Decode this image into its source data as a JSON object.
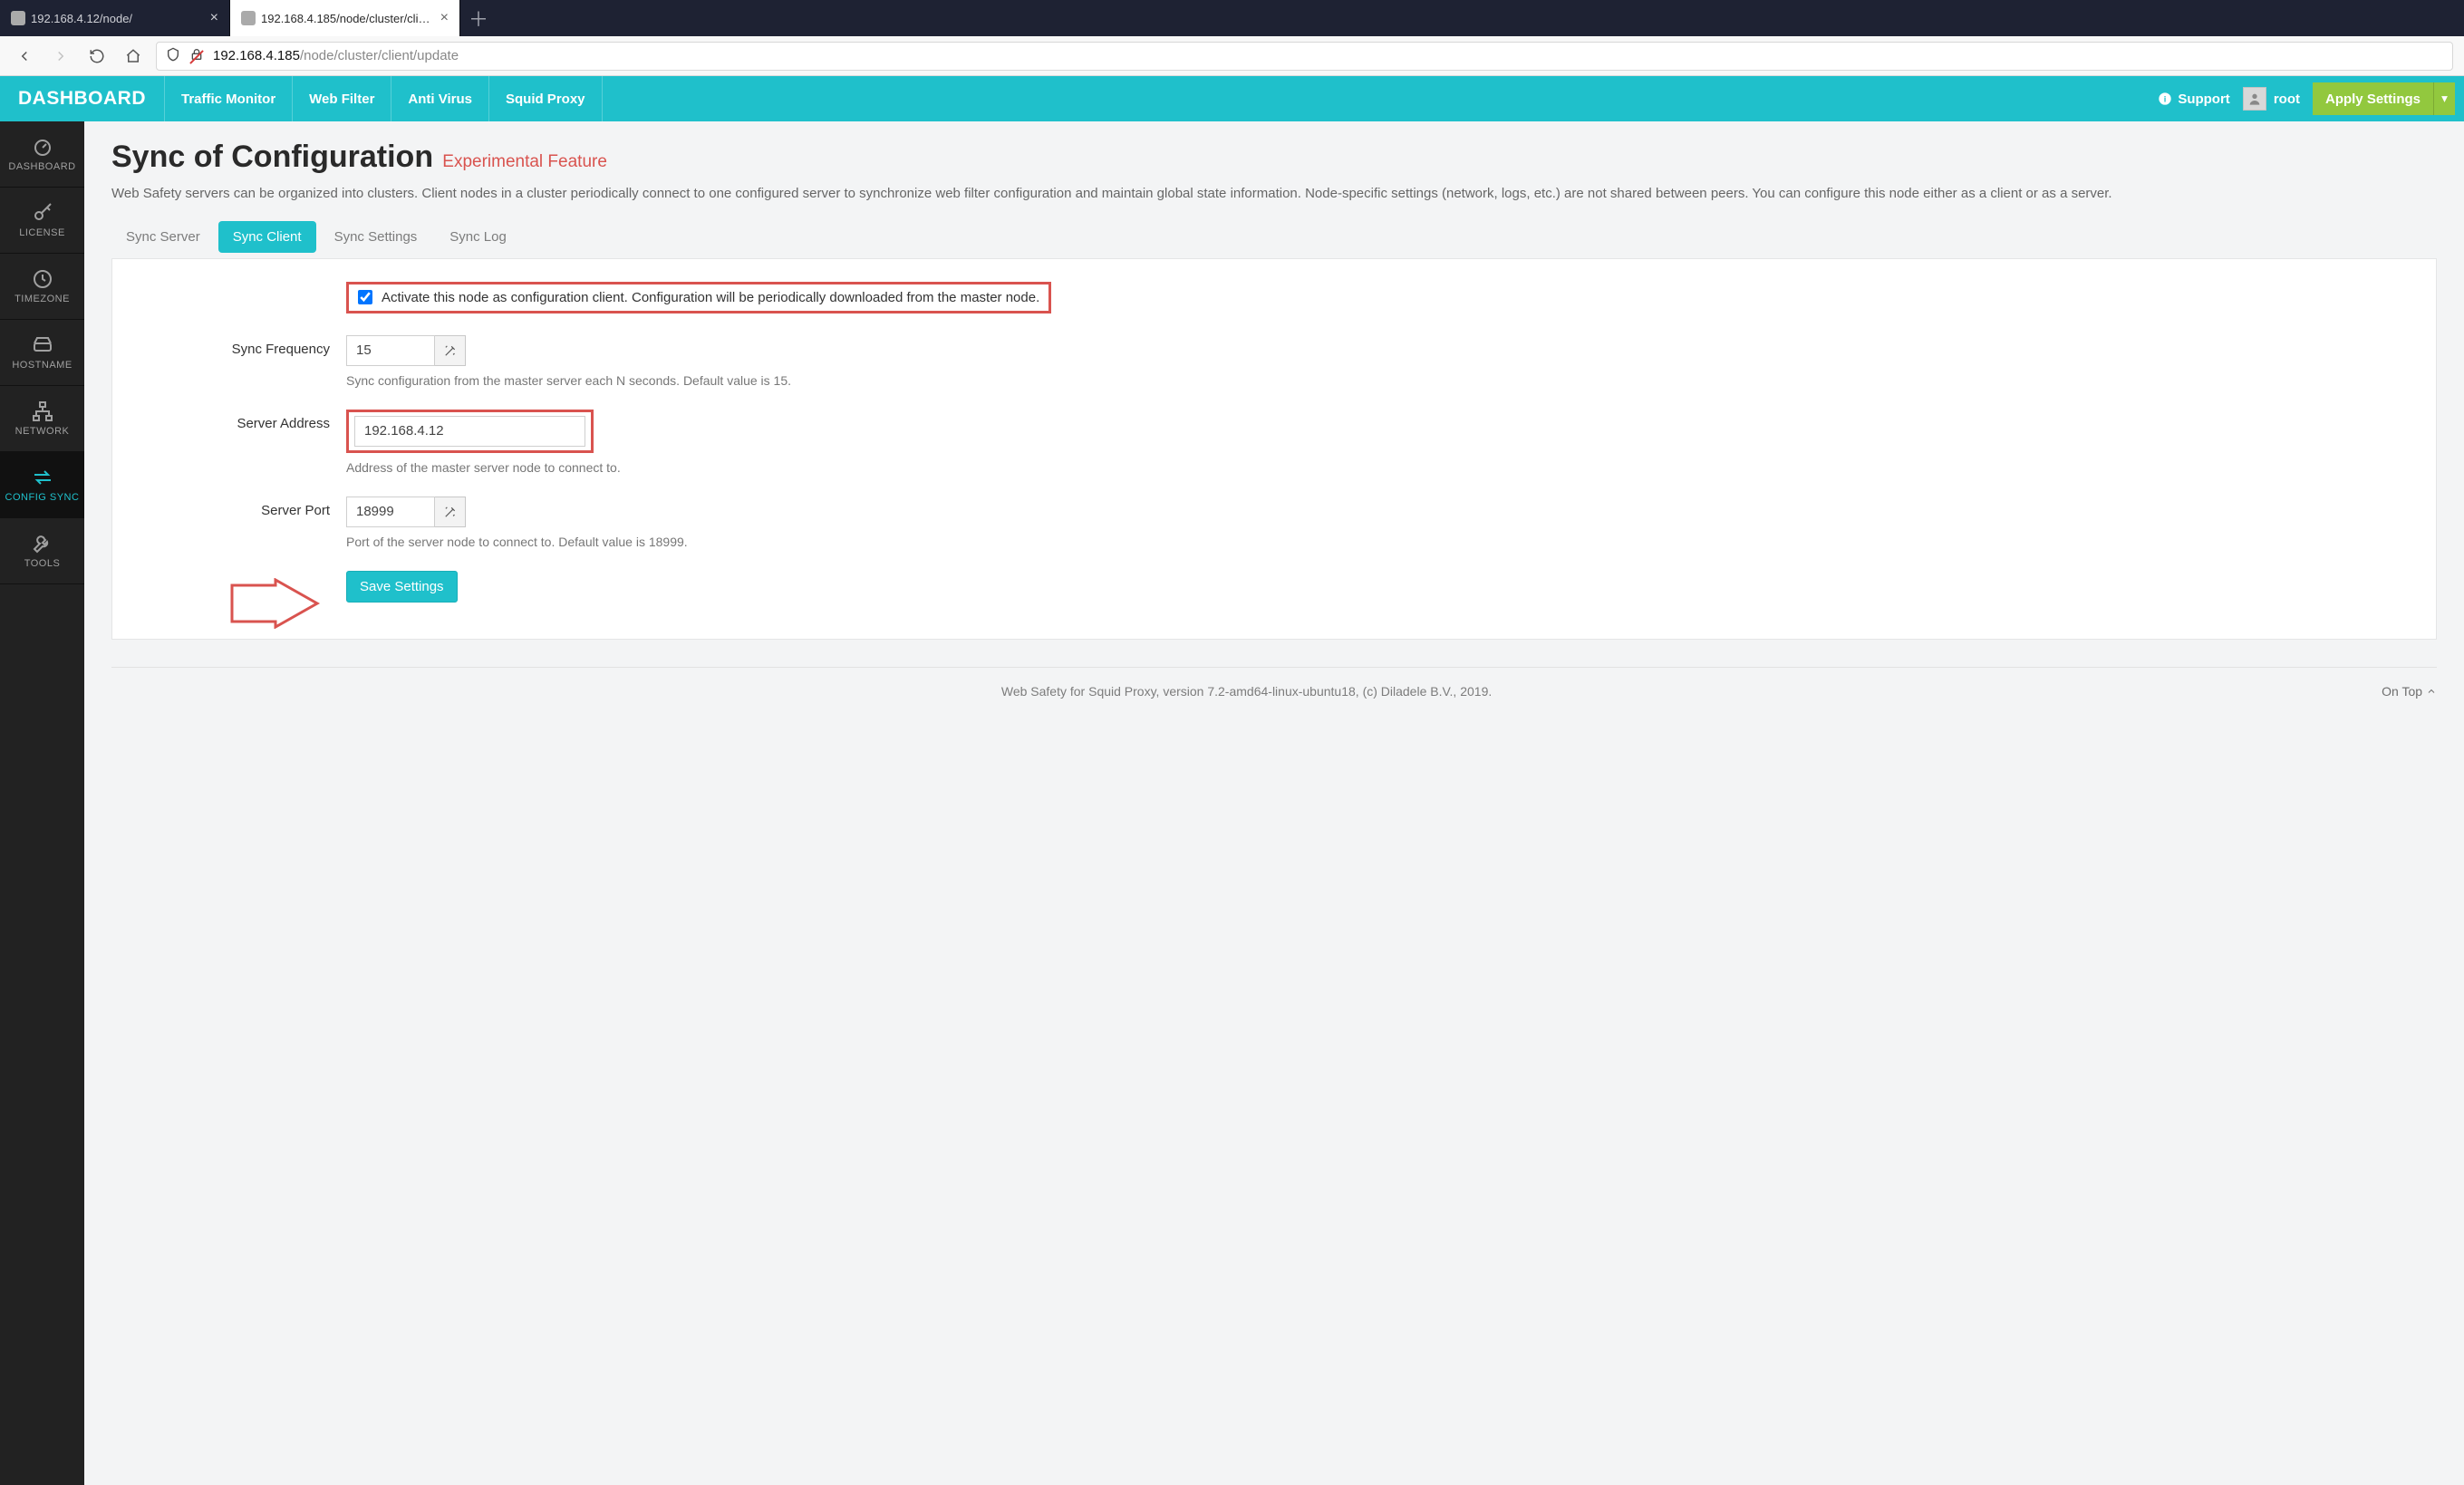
{
  "browser": {
    "tabs": [
      {
        "label": "192.168.4.12/node/",
        "active": false
      },
      {
        "label": "192.168.4.185/node/cluster/client/u",
        "active": true
      }
    ],
    "url_host": "192.168.4.185",
    "url_path": "/node/cluster/client/update"
  },
  "topnav": {
    "brand": "DASHBOARD",
    "links": [
      "Traffic Monitor",
      "Web Filter",
      "Anti Virus",
      "Squid Proxy"
    ],
    "support": "Support",
    "user": "root",
    "apply": "Apply Settings"
  },
  "sidebar": {
    "items": [
      {
        "label": "DASHBOARD",
        "icon": "gauge"
      },
      {
        "label": "LICENSE",
        "icon": "key"
      },
      {
        "label": "TIMEZONE",
        "icon": "clock"
      },
      {
        "label": "HOSTNAME",
        "icon": "hdd"
      },
      {
        "label": "NETWORK",
        "icon": "network"
      },
      {
        "label": "CONFIG SYNC",
        "icon": "sync",
        "active": true
      },
      {
        "label": "TOOLS",
        "icon": "wrench"
      }
    ]
  },
  "page": {
    "title": "Sync of Configuration",
    "exp": "Experimental Feature",
    "intro": "Web Safety servers can be organized into clusters. Client nodes in a cluster periodically connect to one configured server to synchronize web filter configuration and maintain global state information. Node-specific settings (network, logs, etc.) are not shared between peers. You can configure this node either as a client or as a server.",
    "tabs": [
      "Sync Server",
      "Sync Client",
      "Sync Settings",
      "Sync Log"
    ],
    "active_tab": "Sync Client"
  },
  "form": {
    "activate_label": "Activate this node as configuration client. Configuration will be periodically downloaded from the master node.",
    "activate_checked": true,
    "freq_label": "Sync Frequency",
    "freq_value": "15",
    "freq_help": "Sync configuration from the master server each N seconds. Default value is 15.",
    "addr_label": "Server Address",
    "addr_value": "192.168.4.12",
    "addr_help": "Address of the master server node to connect to.",
    "port_label": "Server Port",
    "port_value": "18999",
    "port_help": "Port of the server node to connect to. Default value is 18999.",
    "save": "Save Settings"
  },
  "footer": {
    "text": "Web Safety for Squid Proxy, version 7.2-amd64-linux-ubuntu18, (c) Diladele B.V., 2019.",
    "ontop": "On Top"
  }
}
